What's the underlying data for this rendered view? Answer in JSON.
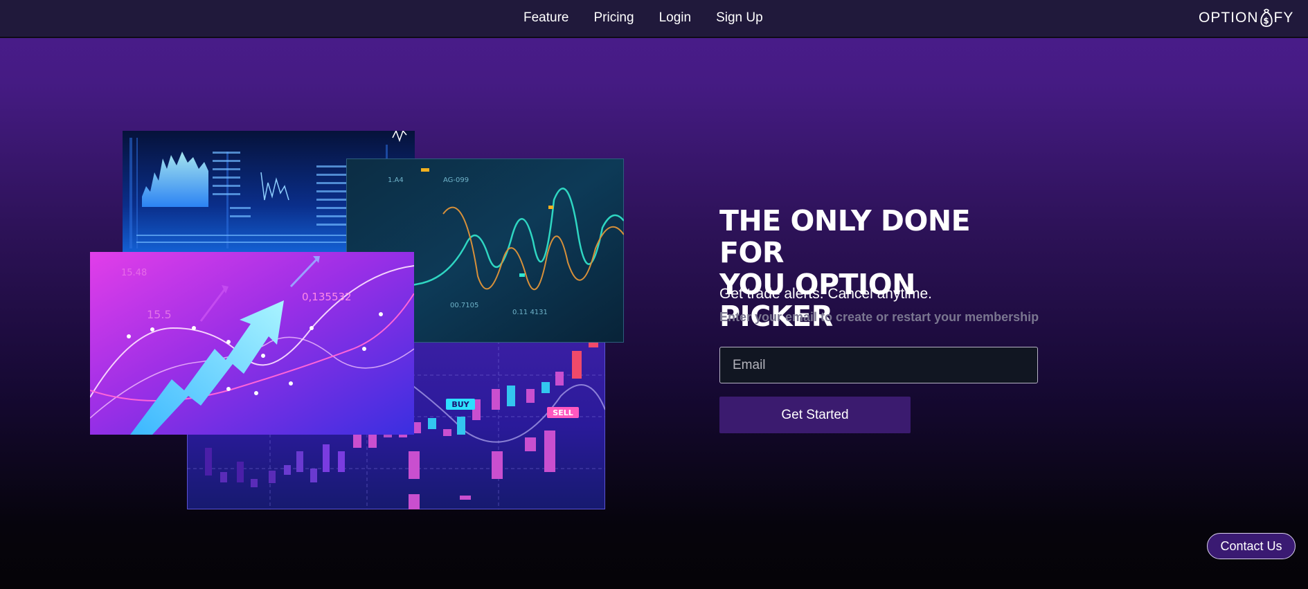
{
  "nav": {
    "links": [
      "Feature",
      "Pricing",
      "Login",
      "Sign Up"
    ]
  },
  "logo": {
    "text_left": "OPTION",
    "text_right": "FY",
    "icon": "money-bag-dollar-icon"
  },
  "collage": {
    "labels": {
      "buy": "BUY",
      "sell": "SELL",
      "value": "0,135532",
      "num_a": "15.5",
      "num_b": "15.48"
    }
  },
  "hero": {
    "title_line1": "THE ONLY DONE FOR",
    "title_line2": "YOU OPTION PICKER",
    "subtitle": "Get trade alerts. Cancel anytime.",
    "hint": "Enter your email to create or restart your membership",
    "email_placeholder": "Email",
    "cta_label": "Get Started"
  },
  "contact": {
    "label": "Contact Us"
  },
  "colors": {
    "nav_bg": "#20193b",
    "accent": "#3b1b6f",
    "hint_text": "#7a7690"
  }
}
